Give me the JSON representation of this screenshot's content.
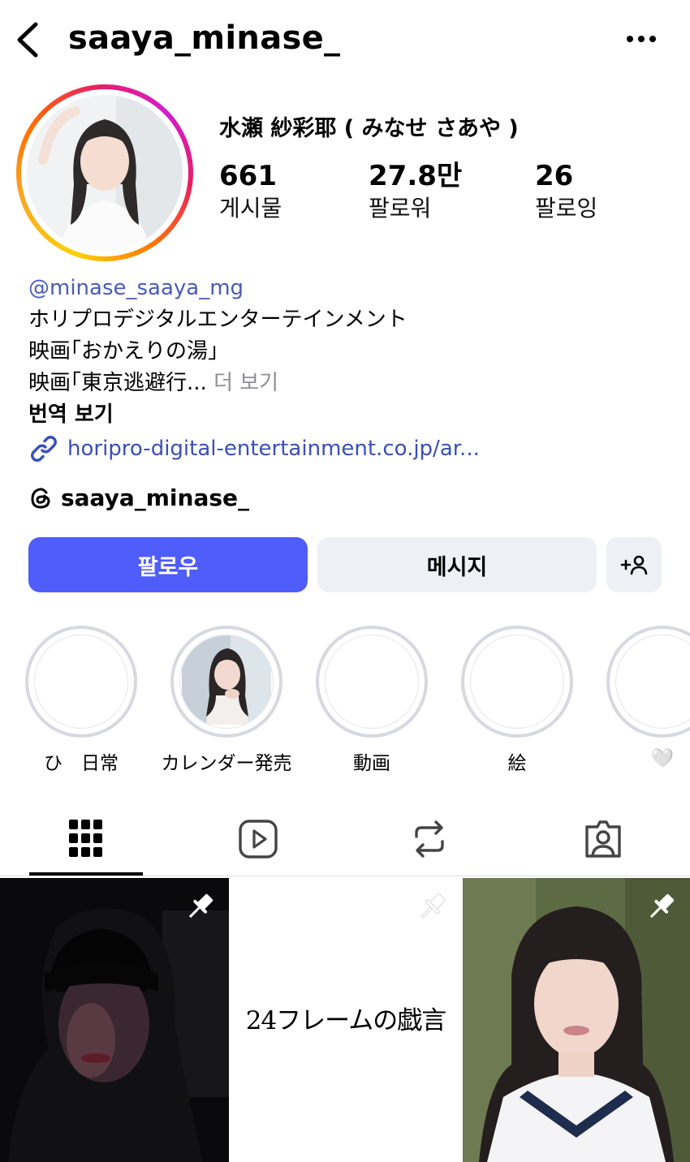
{
  "header": {
    "username": "saaya_minase_"
  },
  "profile": {
    "display_name": "水瀬 紗彩耶 ( みなせ さあや )",
    "stats": [
      {
        "value": "661",
        "label": "게시물"
      },
      {
        "value": "27.8만",
        "label": "팔로워"
      },
      {
        "value": "26",
        "label": "팔로잉"
      }
    ]
  },
  "bio": {
    "handle": "@minase_saaya_mg",
    "line1": "ホリプロデジタルエンターテインメント",
    "line2": "映画｢おかえりの湯」",
    "line3": "映画｢東京逃避行...",
    "more": "더 보기",
    "translate": "번역 보기",
    "link": "horipro-digital-entertainment.co.jp/ar..."
  },
  "threads": {
    "username": "saaya_minase_"
  },
  "buttons": {
    "follow": "팔로우",
    "message": "메시지"
  },
  "highlights": [
    {
      "label": "ひ　日常"
    },
    {
      "label": "カレンダー発売"
    },
    {
      "label": "動画"
    },
    {
      "label": "絵"
    },
    {
      "label": "🤍"
    }
  ],
  "posts": [
    {
      "type": "photo",
      "pinned": true
    },
    {
      "type": "text",
      "text": "24フレームの戯言",
      "pinned": true
    },
    {
      "type": "photo",
      "pinned": true
    }
  ],
  "colors": {
    "follow_button": "#4f5dfb",
    "link": "#3a4fb8",
    "secondary_button": "#eff0f5"
  }
}
